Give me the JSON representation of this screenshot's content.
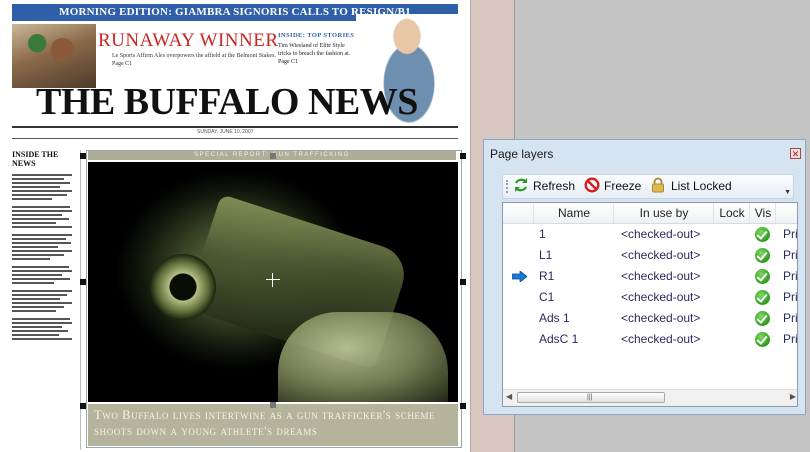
{
  "newspaper": {
    "banner": "MORNING EDITION: GIAMBRA SIGNORIS CALLS TO RESIGN/B1",
    "lead_headline": "RUNAWAY WINNER",
    "lead_subtext": "Le Sports Affirm Ales overpowers the affield at the Belmont Stakes. Page C1",
    "promo_title": "INSIDE: TOP STORIES",
    "promo_text": "Tim Wiesland of Elite Style tricks to breach the fashion at. Page C1",
    "masthead": "THE BUFFALO NEWS",
    "dateline": "SUNDAY, JUNE 10, 2007",
    "side_head": "INSIDE THE NEWS",
    "story_label": "SPECIAL REPORT: GUN TRAFFICKING",
    "caption": "Two Buffalo lives intertwine as a gun trafficker's scheme shoots down a young athlete's dreams"
  },
  "panel": {
    "title": "Page layers",
    "close_icon": "close-icon",
    "toolbar": {
      "refresh_label": "Refresh",
      "freeze_label": "Freeze",
      "list_locked_label": "List Locked"
    },
    "columns": [
      "Name",
      "In use by",
      "Lock",
      "Vis"
    ],
    "rows": [
      {
        "name": "1",
        "in_use_by": "<checked-out>",
        "extra": "Pri",
        "current": false
      },
      {
        "name": "L1",
        "in_use_by": "<checked-out>",
        "extra": "Pri",
        "current": false
      },
      {
        "name": "R1",
        "in_use_by": "<checked-out>",
        "extra": "Pri",
        "current": true
      },
      {
        "name": "C1",
        "in_use_by": "<checked-out>",
        "extra": "Pri",
        "current": false
      },
      {
        "name": "Ads 1",
        "in_use_by": "<checked-out>",
        "extra": "Pri",
        "current": false
      },
      {
        "name": "AdsC 1",
        "in_use_by": "<checked-out>",
        "extra": "Pri",
        "current": false
      }
    ],
    "scroll_grip": "|||"
  },
  "colors": {
    "banner_blue": "#2f5fa8",
    "headline_red": "#c8261f",
    "panel_bg": "#d6e3f1",
    "visible_check": "#2f9a1e",
    "current_arrow": "#1e78d6"
  }
}
